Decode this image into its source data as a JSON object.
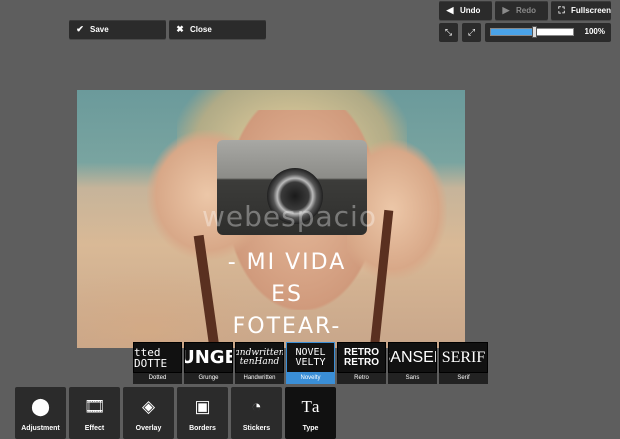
{
  "top_left": {
    "save": {
      "label": "Save",
      "icon": "check-icon"
    },
    "close": {
      "label": "Close",
      "icon": "close-icon"
    }
  },
  "top_right": {
    "undo": {
      "label": "Undo",
      "icon": "arrow-left-icon"
    },
    "redo": {
      "label": "Redo",
      "icon": "arrow-right-icon"
    },
    "fullscreen": {
      "label": "Fullscreen",
      "icon": "fullscreen-icon"
    },
    "zoom": {
      "value_text": "100%",
      "slider_level": 0.52
    }
  },
  "photo": {
    "watermark": "webespacio",
    "overlay_lines": [
      "- MI VIDA",
      "ES",
      "FOTEAR-"
    ]
  },
  "fonts": [
    {
      "preview": "tted DOTTE",
      "label": "Dotted"
    },
    {
      "preview": "UNGE",
      "label": "Grunge"
    },
    {
      "preview": "andwritten tenHand",
      "label": "Handwritten"
    },
    {
      "preview": "NOVEL VELTY",
      "label": "Novelty",
      "active": true
    },
    {
      "preview": "RETRO RETRO",
      "label": "Retro"
    },
    {
      "preview": "SANSER",
      "label": "Sans"
    },
    {
      "preview": "SERIF",
      "label": "Serif"
    }
  ],
  "tools": [
    {
      "label": "Adjustment",
      "icon": "adjustment-icon"
    },
    {
      "label": "Effect",
      "icon": "film-icon"
    },
    {
      "label": "Overlay",
      "icon": "layers-icon"
    },
    {
      "label": "Borders",
      "icon": "border-frame-icon"
    },
    {
      "label": "Stickers",
      "icon": "sticker-icon"
    },
    {
      "label": "Type",
      "icon": "type-icon",
      "active": true
    }
  ],
  "colors": {
    "accent": "#3a8ed6",
    "panel": "#2b2b2b",
    "background": "#5e5e5e"
  }
}
